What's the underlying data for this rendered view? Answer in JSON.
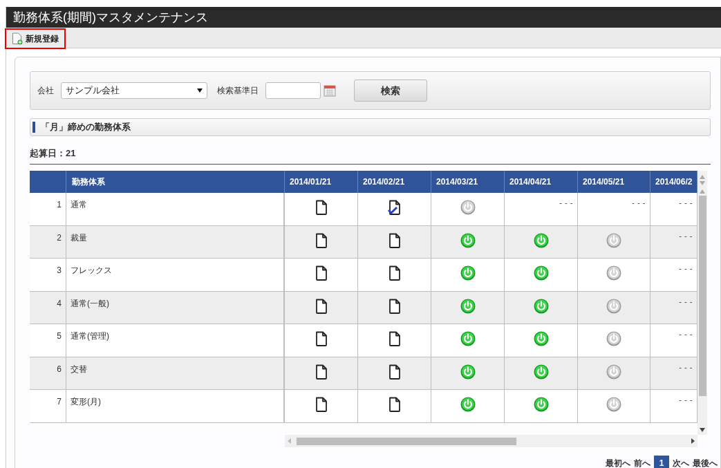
{
  "window": {
    "title": "勤務体系(期間)マスタメンテナンス"
  },
  "toolbar": {
    "new_button": "新規登録"
  },
  "search": {
    "company_label": "会社",
    "company_value": "サンプル会社",
    "date_label": "検索基準日",
    "search_button": "検索"
  },
  "section": {
    "title": "「月」締めの勤務体系",
    "start_day": "起算日：21"
  },
  "table": {
    "columns": [
      "",
      "勤務体系",
      "2014/01/21",
      "2014/02/21",
      "2014/03/21",
      "2014/04/21",
      "2014/05/21",
      "2014/06/2"
    ],
    "rows": [
      {
        "no": "1",
        "name": "通常",
        "cells": [
          {
            "kind": "doc"
          },
          {
            "kind": "doc_checked"
          },
          {
            "kind": "power_off"
          },
          {
            "kind": "text",
            "text": "- - -"
          },
          {
            "kind": "text",
            "text": "- - -"
          },
          {
            "kind": "text",
            "text": "- - -"
          }
        ]
      },
      {
        "no": "2",
        "name": "裁量",
        "cells": [
          {
            "kind": "doc"
          },
          {
            "kind": "doc"
          },
          {
            "kind": "power_on"
          },
          {
            "kind": "power_on"
          },
          {
            "kind": "power_off"
          },
          {
            "kind": "text",
            "text": "- - -"
          }
        ]
      },
      {
        "no": "3",
        "name": "フレックス",
        "cells": [
          {
            "kind": "doc"
          },
          {
            "kind": "doc"
          },
          {
            "kind": "power_on"
          },
          {
            "kind": "power_on"
          },
          {
            "kind": "power_off"
          },
          {
            "kind": "text",
            "text": "- - -"
          }
        ]
      },
      {
        "no": "4",
        "name": "通常(一般)",
        "cells": [
          {
            "kind": "doc"
          },
          {
            "kind": "doc"
          },
          {
            "kind": "power_on"
          },
          {
            "kind": "power_on"
          },
          {
            "kind": "power_off"
          },
          {
            "kind": "text",
            "text": "- - -"
          }
        ]
      },
      {
        "no": "5",
        "name": "通常(管理)",
        "cells": [
          {
            "kind": "doc"
          },
          {
            "kind": "doc"
          },
          {
            "kind": "power_on"
          },
          {
            "kind": "power_on"
          },
          {
            "kind": "power_off"
          },
          {
            "kind": "text",
            "text": "- - -"
          }
        ]
      },
      {
        "no": "6",
        "name": "交替",
        "cells": [
          {
            "kind": "doc"
          },
          {
            "kind": "doc"
          },
          {
            "kind": "power_on"
          },
          {
            "kind": "power_on"
          },
          {
            "kind": "power_off"
          },
          {
            "kind": "text",
            "text": "- - -"
          }
        ]
      },
      {
        "no": "7",
        "name": "変形(月)",
        "cells": [
          {
            "kind": "doc"
          },
          {
            "kind": "doc"
          },
          {
            "kind": "power_on"
          },
          {
            "kind": "power_on"
          },
          {
            "kind": "power_off"
          },
          {
            "kind": "text",
            "text": "- - -"
          }
        ]
      }
    ]
  },
  "pagination": {
    "first": "最初へ",
    "prev": "前へ",
    "pages": [
      {
        "label": "1",
        "selected": true
      }
    ],
    "next": "次へ",
    "last": "最後へ"
  }
}
